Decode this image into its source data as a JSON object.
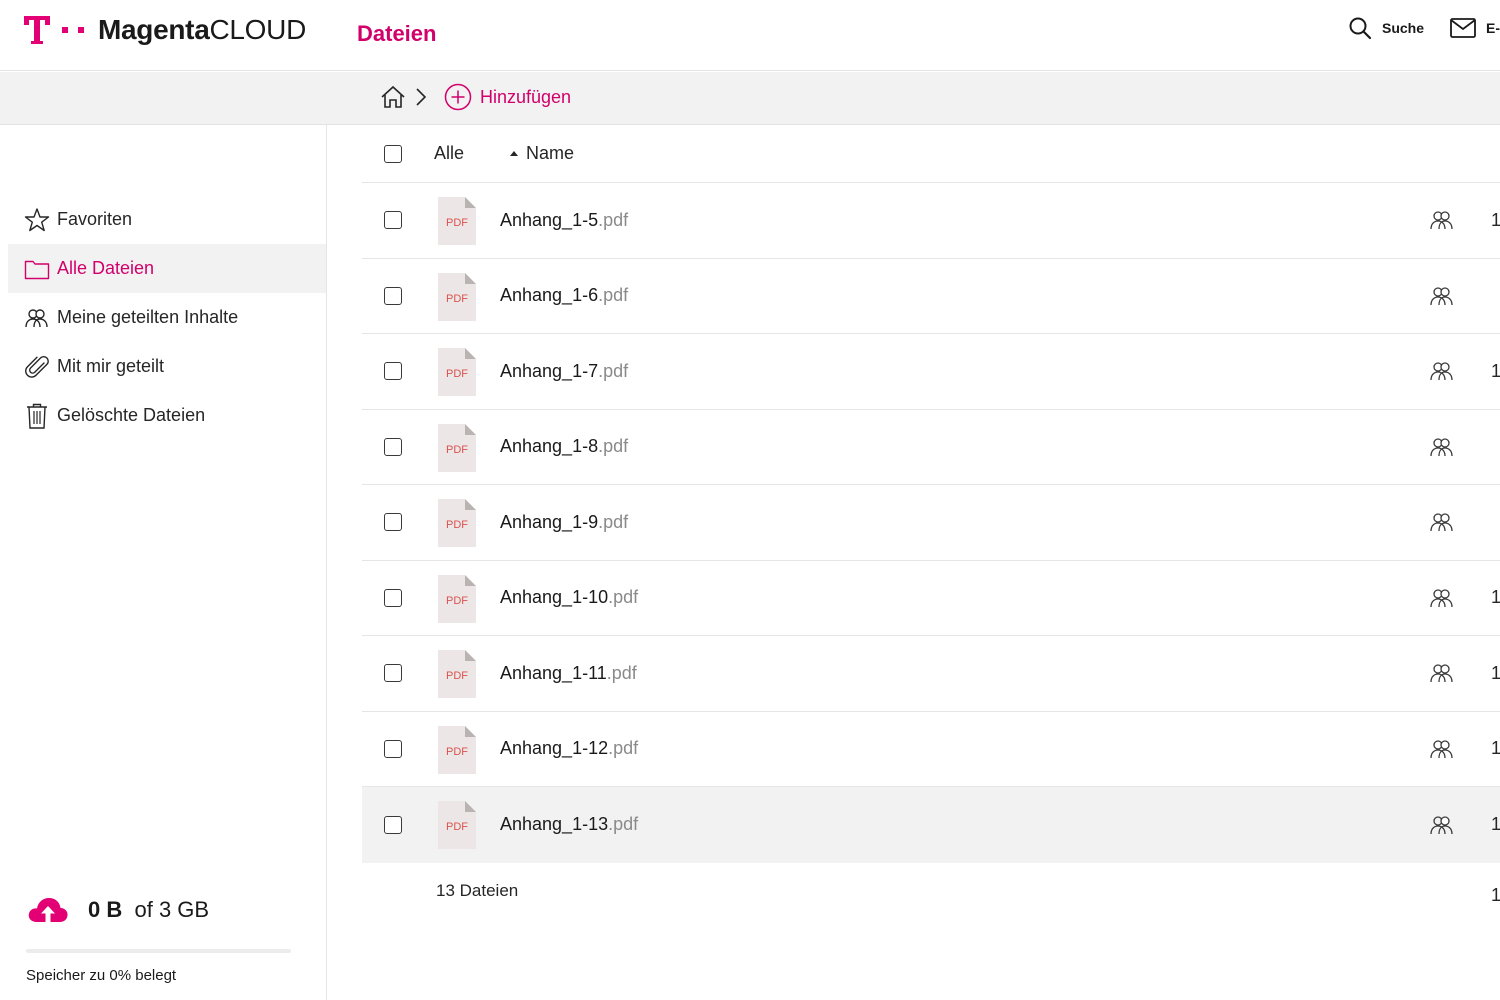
{
  "header": {
    "brand_prefix": "Magenta",
    "brand_suffix": "CLOUD",
    "section_title": "Dateien",
    "search_label": "Suche",
    "mail_label": "E-"
  },
  "toolbar": {
    "add_label": "Hinzufügen"
  },
  "sidebar": {
    "items": [
      {
        "label": "Favoriten",
        "icon": "star-icon",
        "active": false
      },
      {
        "label": "Alle Dateien",
        "icon": "folder-icon",
        "active": true
      },
      {
        "label": "Meine geteilten Inhalte",
        "icon": "shared-users-icon",
        "active": false
      },
      {
        "label": "Mit mir geteilt",
        "icon": "paperclip-icon",
        "active": false
      },
      {
        "label": "Gelöschte Dateien",
        "icon": "trash-icon",
        "active": false
      }
    ],
    "storage": {
      "used": "0 B",
      "of_total": "of 3 GB",
      "usage_text": "Speicher zu 0% belegt",
      "usage_percent": 0
    }
  },
  "list": {
    "select_all_label": "Alle",
    "name_header": "Name",
    "files": [
      {
        "base": "Anhang_1-5",
        "ext": ".pdf",
        "size": "1"
      },
      {
        "base": "Anhang_1-6",
        "ext": ".pdf",
        "size": ""
      },
      {
        "base": "Anhang_1-7",
        "ext": ".pdf",
        "size": "1"
      },
      {
        "base": "Anhang_1-8",
        "ext": ".pdf",
        "size": ""
      },
      {
        "base": "Anhang_1-9",
        "ext": ".pdf",
        "size": ""
      },
      {
        "base": "Anhang_1-10",
        "ext": ".pdf",
        "size": "1"
      },
      {
        "base": "Anhang_1-11",
        "ext": ".pdf",
        "size": "1"
      },
      {
        "base": "Anhang_1-12",
        "ext": ".pdf",
        "size": "1"
      },
      {
        "base": "Anhang_1-13",
        "ext": ".pdf",
        "size": "1"
      }
    ],
    "file_type_label": "PDF",
    "file_count": "13 Dateien",
    "footer_size": "1"
  },
  "colors": {
    "brand": "#e20074",
    "accent_text": "#d1006b",
    "pdf_red": "#d9534f"
  }
}
